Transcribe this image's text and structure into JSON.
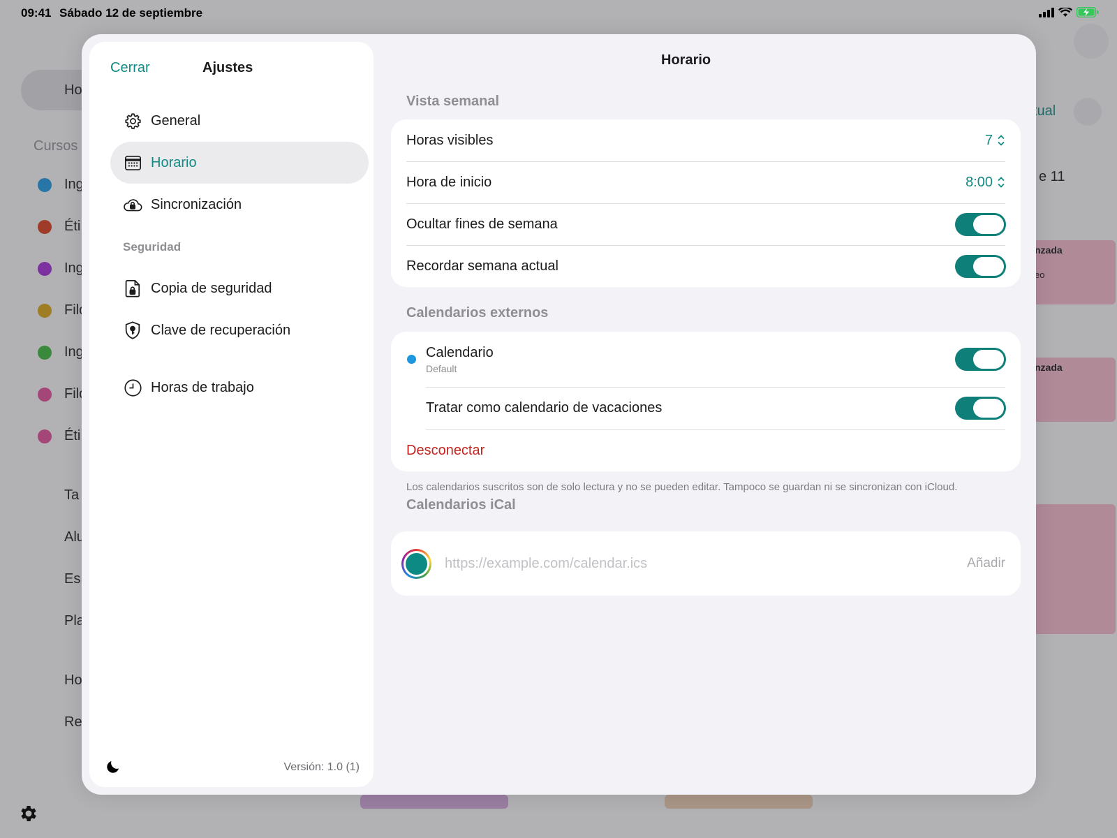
{
  "status_bar": {
    "time": "09:41",
    "date": "Sábado 12 de septiembre"
  },
  "background": {
    "sidebar_items": [
      "Ho",
      "Ing",
      "Éti",
      "Ing",
      "Filo",
      "Ing",
      "Filo",
      "Éti",
      "Ta",
      "Alu",
      "Es",
      "Pla",
      "Ho",
      "Re"
    ],
    "sidebar_section": "Cursos",
    "course_colors": [
      "#1c97e0",
      "#d63a1a",
      "#a12ad3",
      "#d7a215",
      "#3ab43a",
      "#e04c96",
      "#e04c96"
    ],
    "partial_labels": [
      "tual",
      "e 11",
      "nzada",
      "eo",
      "nzada"
    ]
  },
  "settings": {
    "close_label": "Cerrar",
    "title": "Ajustes",
    "nav": [
      {
        "label": "General",
        "icon": "gear-icon"
      },
      {
        "label": "Horario",
        "icon": "calendar-icon",
        "active": true
      },
      {
        "label": "Sincronización",
        "icon": "cloud-lock-icon"
      }
    ],
    "security_header": "Seguridad",
    "security_items": [
      {
        "label": "Copia de seguridad",
        "icon": "doc-lock-icon"
      },
      {
        "label": "Clave de recuperación",
        "icon": "shield-key-icon"
      }
    ],
    "work_hours_label": "Horas de trabajo",
    "version": "Versión: 1.0 (1)"
  },
  "content": {
    "title": "Horario",
    "weekly": {
      "header": "Vista semanal",
      "rows": [
        {
          "label": "Horas visibles",
          "value": "7"
        },
        {
          "label": "Hora de inicio",
          "value": "8:00"
        },
        {
          "label": "Ocultar fines de semana",
          "toggle": true
        },
        {
          "label": "Recordar semana actual",
          "toggle": true
        }
      ]
    },
    "external": {
      "header": "Calendarios externos",
      "calendar_name": "Calendario",
      "calendar_source": "Default",
      "calendar_enabled": true,
      "holiday_label": "Tratar como calendario de vacaciones",
      "holiday_enabled": true,
      "disconnect_label": "Desconectar",
      "footnote": "Los calendarios suscritos son de solo lectura y no se pueden editar. Tampoco se guardan ni se sincronizan con iCloud."
    },
    "ical": {
      "header": "Calendarios iCal",
      "placeholder": "https://example.com/calendar.ics",
      "add_label": "Añadir"
    }
  },
  "colors": {
    "accent": "#118a84",
    "toggle_on": "#0e7f79",
    "destructive": "#c4241f",
    "calendar_dot": "#1c97e0"
  }
}
